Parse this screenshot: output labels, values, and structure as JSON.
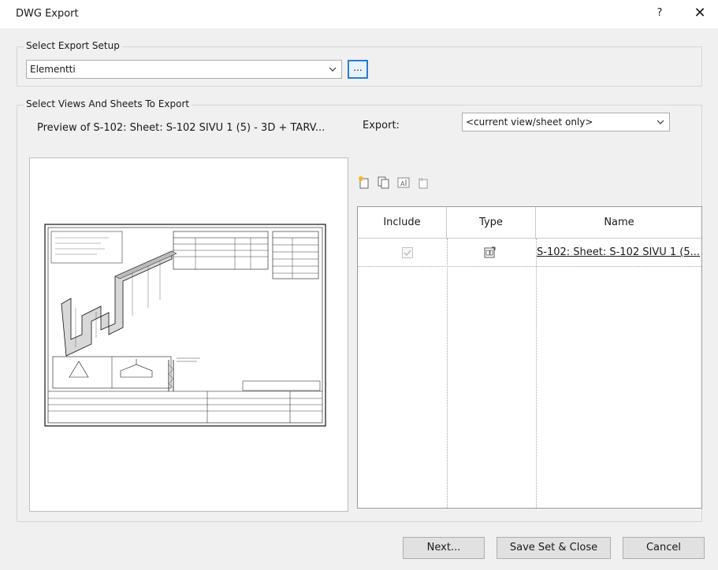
{
  "window": {
    "title": "DWG Export",
    "help_label": "?",
    "close_label": "✕"
  },
  "export_setup": {
    "group_label": "Select Export Setup",
    "selected": "Elementti",
    "more_button_label": "..."
  },
  "views": {
    "group_label": "Select Views And Sheets To Export",
    "preview_label": "Preview of S-102: Sheet: S-102  SIVU 1 (5) - 3D + TARV...",
    "export_label": "Export:",
    "export_selected": "<current view/sheet only>"
  },
  "toolbar": {
    "icons": [
      "new-set-icon",
      "duplicate-set-icon",
      "rename-set-icon",
      "delete-set-icon"
    ]
  },
  "table": {
    "columns": [
      "Include",
      "Type",
      "Name"
    ],
    "rows": [
      {
        "include": true,
        "type_icon": "sheet-icon",
        "name": "S-102: Sheet: S-102  SIVU 1 (5..."
      }
    ]
  },
  "buttons": {
    "next": "Next...",
    "save_set_close": "Save Set & Close",
    "cancel": "Cancel"
  }
}
